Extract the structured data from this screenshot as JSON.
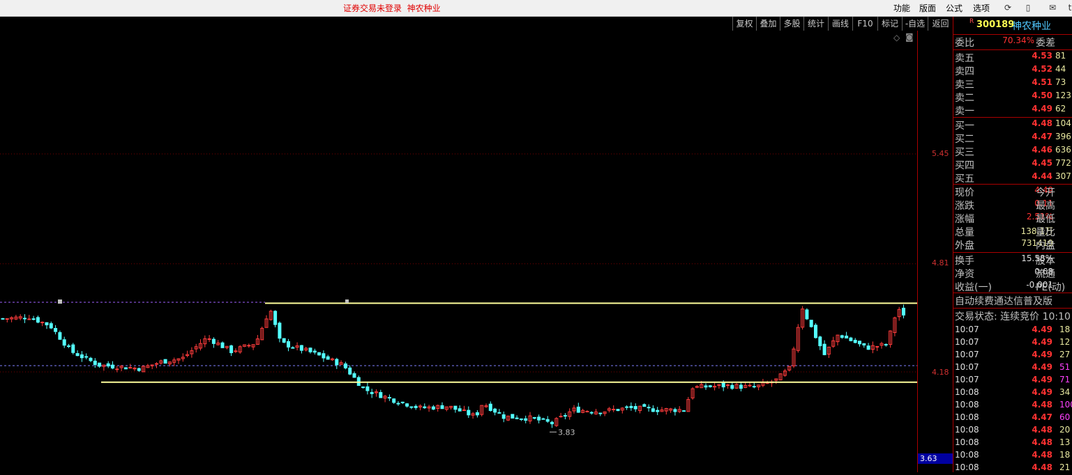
{
  "topbar": {
    "status_text": "证券交易未登录  神农种业",
    "menus": [
      "功能",
      "版面",
      "公式",
      "选项"
    ],
    "icons": [
      "refresh-icon",
      "phone-icon",
      "mail-icon",
      "t-icon"
    ]
  },
  "toolbar": {
    "buttons": [
      "复权",
      "叠加",
      "多股",
      "统计",
      "画线",
      "F10",
      "标记",
      "-自选",
      "返回"
    ]
  },
  "price_axis": {
    "labels": [
      "5.45",
      "4.81",
      "4.18"
    ],
    "low_label": "3.63"
  },
  "chart": {
    "low_annotation": "3.83",
    "colors": {
      "up": "#ff3c3c",
      "down": "#54ffff",
      "level_line": "#ffff9c",
      "grid": "#7a0000",
      "dash_blue": "#8080ff",
      "dash_purple": "#a060ff"
    }
  },
  "chart_data": {
    "type": "candlestick",
    "price_range": [
      3.63,
      5.95
    ],
    "grid_prices": [
      5.45,
      4.81,
      4.18
    ],
    "horizontal_levels": [
      4.58,
      4.12
    ],
    "marked_low": 3.83
  },
  "quote": {
    "header_r": "R",
    "code": "300189",
    "name": "神农种业",
    "ratio_label": "委比",
    "ratio_value": "70.34%",
    "diff_label": "委差",
    "asks": [
      {
        "label": "卖五",
        "price": "4.53",
        "vol": "81"
      },
      {
        "label": "卖四",
        "price": "4.52",
        "vol": "44"
      },
      {
        "label": "卖三",
        "price": "4.51",
        "vol": "73"
      },
      {
        "label": "卖二",
        "price": "4.50",
        "vol": "123"
      },
      {
        "label": "卖一",
        "price": "4.49",
        "vol": "62"
      }
    ],
    "bids": [
      {
        "label": "买一",
        "price": "4.48",
        "vol": "104"
      },
      {
        "label": "买二",
        "price": "4.47",
        "vol": "396"
      },
      {
        "label": "买三",
        "price": "4.46",
        "vol": "636"
      },
      {
        "label": "买四",
        "price": "4.45",
        "vol": "772"
      },
      {
        "label": "买五",
        "price": "4.44",
        "vol": "307"
      }
    ],
    "stats": [
      {
        "label": "现价",
        "value": "4.49",
        "extra": "今开"
      },
      {
        "label": "涨跌",
        "value": "0.11",
        "extra": "最高"
      },
      {
        "label": "涨幅",
        "value": "2.51%",
        "extra": "最低"
      },
      {
        "label": "总量",
        "value": "138.1万",
        "extra": "量比"
      },
      {
        "label": "外盘",
        "value": "731419",
        "extra": "内盘"
      }
    ],
    "stats2": [
      {
        "label": "换手",
        "value": "15.58%",
        "extra": "股本"
      },
      {
        "label": "净资",
        "value": "0.68",
        "extra": "流通"
      },
      {
        "label": "收益(一)",
        "value": "-0.001",
        "extra": "PE(动)"
      }
    ],
    "notice": "自动续费通达信普及版",
    "trade_state": "交易状态: 连续竞价 10:10",
    "ticks": [
      {
        "time": "10:07",
        "price": "4.49",
        "vol": "18",
        "color": "#e8e8a0"
      },
      {
        "time": "10:07",
        "price": "4.49",
        "vol": "12",
        "color": "#e8e8a0"
      },
      {
        "time": "10:07",
        "price": "4.49",
        "vol": "27",
        "color": "#e8e8a0"
      },
      {
        "time": "10:07",
        "price": "4.49",
        "vol": "51",
        "color": "#ff40ff"
      },
      {
        "time": "10:07",
        "price": "4.49",
        "vol": "71",
        "color": "#ff40ff"
      },
      {
        "time": "10:08",
        "price": "4.49",
        "vol": "34",
        "color": "#e8e8a0"
      },
      {
        "time": "10:08",
        "price": "4.48",
        "vol": "100",
        "color": "#ff40ff"
      },
      {
        "time": "10:08",
        "price": "4.47",
        "vol": "60",
        "color": "#ff40ff"
      },
      {
        "time": "10:08",
        "price": "4.48",
        "vol": "20",
        "color": "#e8e8a0"
      },
      {
        "time": "10:08",
        "price": "4.48",
        "vol": "13",
        "color": "#e8e8a0"
      },
      {
        "time": "10:08",
        "price": "4.48",
        "vol": "18",
        "color": "#e8e8a0"
      },
      {
        "time": "10:08",
        "price": "4.48",
        "vol": "21",
        "color": "#e8e8a0"
      }
    ]
  }
}
